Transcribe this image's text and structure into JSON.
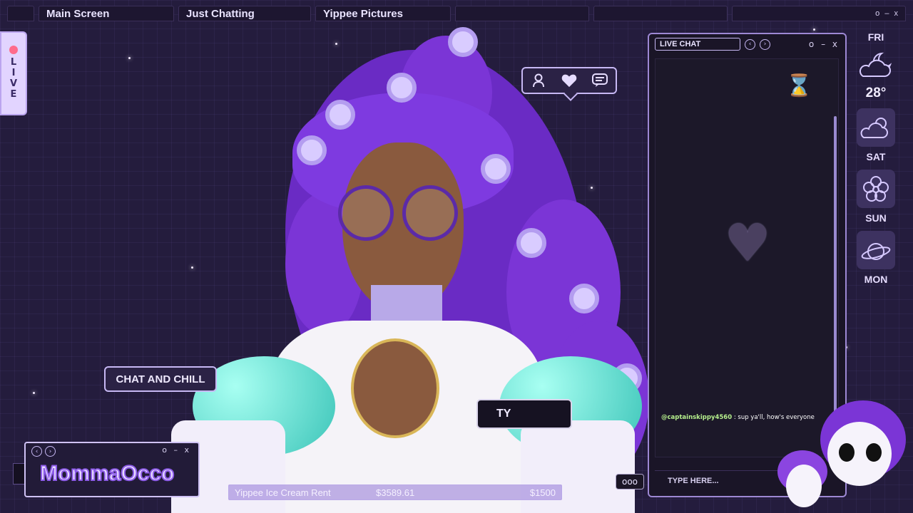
{
  "tabs": [
    {
      "label": ""
    },
    {
      "label": "Main Screen"
    },
    {
      "label": "Just Chatting"
    },
    {
      "label": "Yippee Pictures"
    },
    {
      "label": ""
    },
    {
      "label": ""
    },
    {
      "label": ""
    }
  ],
  "window_controls": "o – x",
  "live_tab": {
    "letters": [
      "L",
      "I",
      "V",
      "E"
    ],
    "dot_color": "#ff6b8b"
  },
  "social_icons": [
    "user-icon",
    "heart-icon",
    "chat-bubble-icon"
  ],
  "bubbles": {
    "chat_and_chill": "CHAT AND CHILL",
    "ty": "TY"
  },
  "live_chat": {
    "title": "LIVE CHAT",
    "controls": "o – x",
    "message_user": "@captainskippy4560",
    "message_text": " : sup ya'll, how's everyone",
    "input_placeholder": "TYPE HERE..."
  },
  "weather": {
    "today": "FRI",
    "temperature": "28°",
    "days": [
      "SAT",
      "SUN",
      "MON"
    ],
    "icons": [
      "moon-cloud-icon",
      "sun-cloud-icon",
      "flower-icon",
      "planet-icon"
    ]
  },
  "logo": {
    "text": "MommaOcco",
    "controls": "o – x"
  },
  "goal": {
    "name": "Yippee Ice Cream Rent",
    "current": "$3589.61",
    "target": "$1500",
    "progress": 1.0
  },
  "more_button": "ooo",
  "colors": {
    "accent": "#c7b8f4",
    "background": "#241c3d",
    "hair": "#7b35d6",
    "chat_user": "#b6f08d"
  }
}
